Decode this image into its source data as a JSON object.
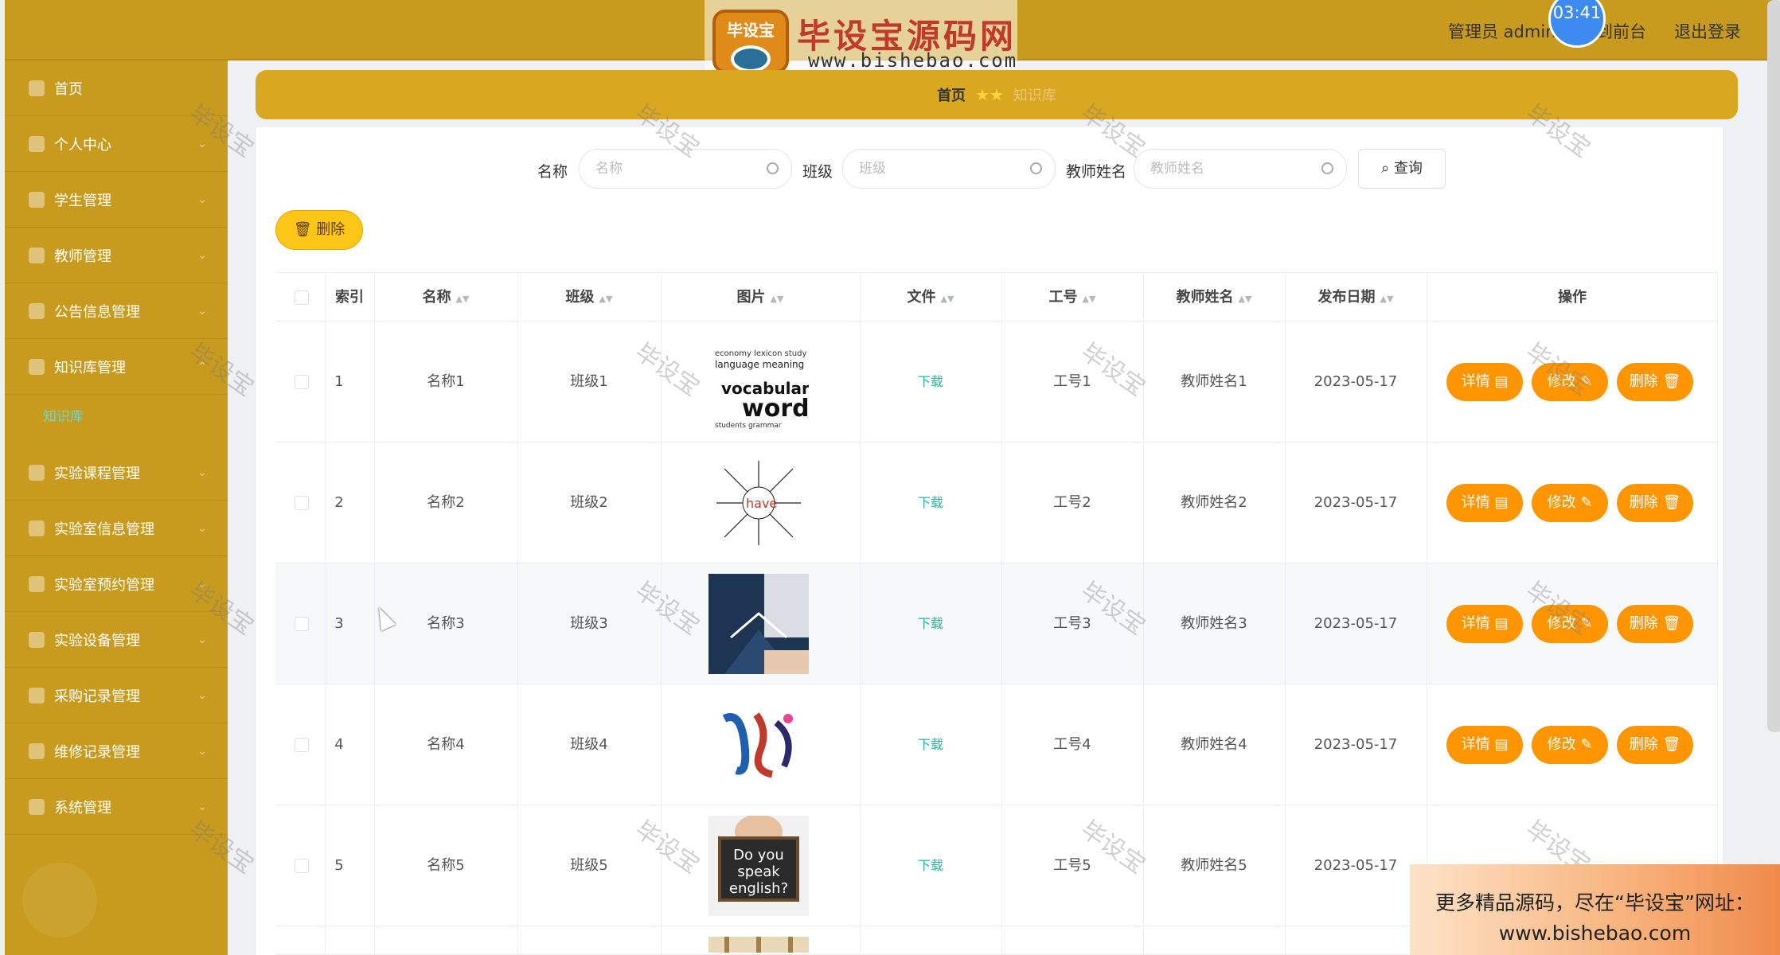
{
  "header": {
    "logo_badge": "毕设宝",
    "logo_title": "毕设宝源码网",
    "logo_url": "www.bishebao.com",
    "user_label": "管理员 admin",
    "front_link": "回到前台",
    "logout": "退出登录",
    "clock": "03:41",
    "brand_color": "#c89b1e"
  },
  "sidebar": {
    "items": [
      {
        "label": "首页",
        "icon": "home-icon"
      },
      {
        "label": "个人中心",
        "icon": "user-icon"
      },
      {
        "label": "学生管理",
        "icon": "student-icon"
      },
      {
        "label": "教师管理",
        "icon": "teacher-icon"
      },
      {
        "label": "公告信息管理",
        "icon": "notice-icon"
      },
      {
        "label": "知识库管理",
        "icon": "book-icon"
      },
      {
        "label": "实验课程管理",
        "icon": "course-icon"
      },
      {
        "label": "实验室信息管理",
        "icon": "lab-icon"
      },
      {
        "label": "实验室预约管理",
        "icon": "calendar-icon"
      },
      {
        "label": "实验设备管理",
        "icon": "device-icon"
      },
      {
        "label": "采购记录管理",
        "icon": "purchase-icon"
      },
      {
        "label": "维修记录管理",
        "icon": "repair-icon"
      },
      {
        "label": "系统管理",
        "icon": "system-icon"
      }
    ],
    "sub_item": "知识库"
  },
  "breadcrumb": {
    "home": "首页",
    "current": "知识库"
  },
  "search": {
    "name_label": "名称",
    "name_placeholder": "名称",
    "class_label": "班级",
    "class_placeholder": "班级",
    "teacher_label": "教师姓名",
    "teacher_placeholder": "教师姓名",
    "query_button": "查询"
  },
  "toolbar": {
    "delete_button": "删除"
  },
  "table": {
    "headers": [
      "索引",
      "名称",
      "班级",
      "图片",
      "文件",
      "工号",
      "教师姓名",
      "发布日期",
      "操作"
    ],
    "rows": [
      {
        "index": "1",
        "name": "名称1",
        "class": "班级1",
        "file": "下载",
        "job_no": "工号1",
        "teacher": "教师姓名1",
        "date": "2023-05-17",
        "image": "vocabulary words"
      },
      {
        "index": "2",
        "name": "名称2",
        "class": "班级2",
        "file": "下载",
        "job_no": "工号2",
        "teacher": "教师姓名2",
        "date": "2023-05-17",
        "image": "have"
      },
      {
        "index": "3",
        "name": "名称3",
        "class": "班级3",
        "file": "下载",
        "job_no": "工号3",
        "teacher": "教师姓名3",
        "date": "2023-05-17",
        "image": "books"
      },
      {
        "index": "4",
        "name": "名称4",
        "class": "班级4",
        "file": "下载",
        "job_no": "工号4",
        "teacher": "教师姓名4",
        "date": "2023-05-17",
        "image": "calligraphy"
      },
      {
        "index": "5",
        "name": "名称5",
        "class": "班级5",
        "file": "下载",
        "job_no": "工号5",
        "teacher": "教师姓名5",
        "date": "2023-05-17",
        "image": "Do you speak english?"
      }
    ],
    "actions": {
      "detail": "详情",
      "edit": "修改",
      "delete": "删除"
    }
  },
  "watermark": "毕设宝",
  "promo": {
    "line1": "更多精品源码，尽在“毕设宝”网址：",
    "line2": "www.bishebao.com"
  }
}
